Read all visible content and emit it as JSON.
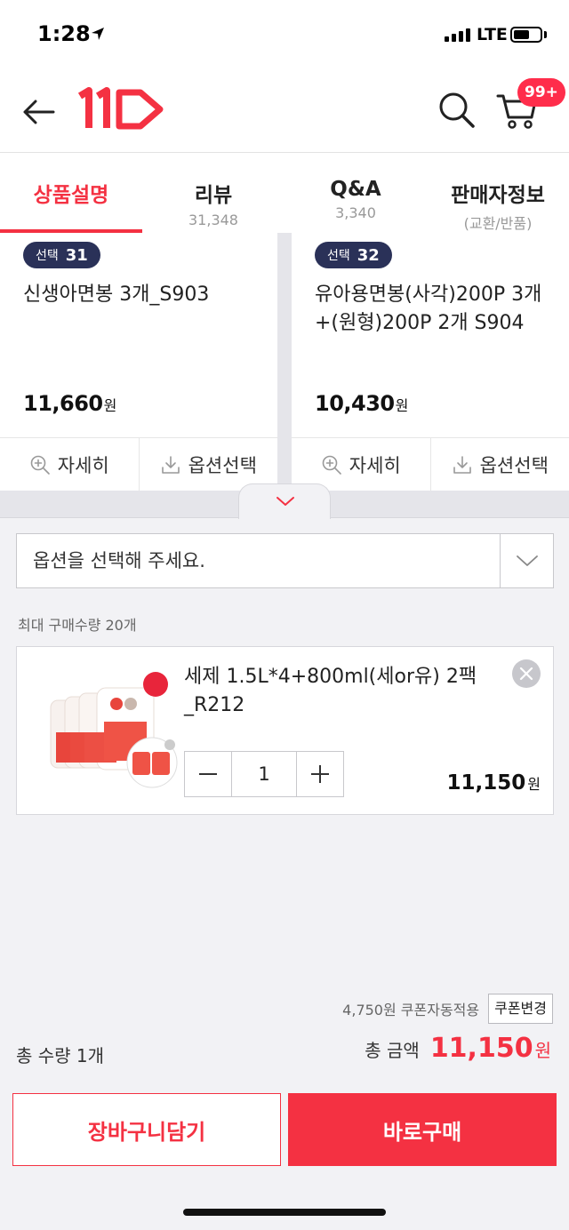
{
  "status_bar": {
    "time": "1:28",
    "network": "LTE"
  },
  "header": {
    "cart_badge": "99+"
  },
  "tabs": [
    {
      "label": "상품설명",
      "sub": ""
    },
    {
      "label": "리뷰",
      "sub": "31,348"
    },
    {
      "label": "Q&A",
      "sub": "3,340"
    },
    {
      "label": "판매자정보",
      "sub": "(교환/반품)"
    }
  ],
  "cards": [
    {
      "badge_label": "선택",
      "badge_number": "31",
      "title": "신생아면봉 3개_S903",
      "price": "11,660",
      "price_unit": "원",
      "detail_label": "자세히",
      "option_label": "옵션선택"
    },
    {
      "badge_label": "선택",
      "badge_number": "32",
      "title": "유아용면봉(사각)200P 3개+(원형)200P 2개 S904",
      "price": "10,430",
      "price_unit": "원",
      "detail_label": "자세히",
      "option_label": "옵션선택"
    }
  ],
  "option_select": {
    "placeholder": "옵션을 선택해 주세요."
  },
  "max_quantity": "최대 구매수량 20개",
  "selected_item": {
    "name": "세제 1.5L*4+800ml(세or유) 2팩_R212",
    "quantity": "1",
    "price": "11,150",
    "price_unit": "원"
  },
  "coupon": {
    "text": "4,750원 쿠폰자동적용",
    "button": "쿠폰변경"
  },
  "totals": {
    "quantity_text": "총 수량 1개",
    "amount_label": "총 금액",
    "amount_value": "11,150",
    "amount_unit": "원"
  },
  "actions": {
    "add_to_cart": "장바구니담기",
    "buy_now": "바로구매"
  },
  "colors": {
    "accent": "#f43142",
    "badge_bg": "#2a3158"
  }
}
